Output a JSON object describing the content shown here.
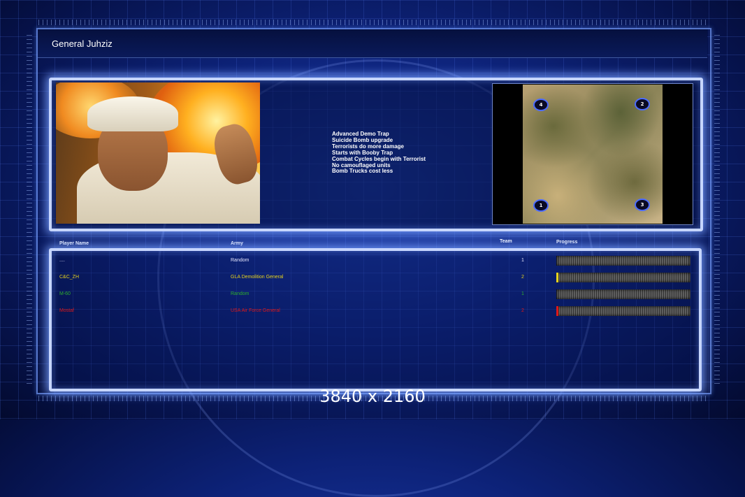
{
  "title": "General Juhziz",
  "bonuses": [
    "Advanced Demo Trap",
    "Suicide Bomb upgrade",
    "Terrorists do more damage",
    "Starts with Booby Trap",
    "Combat Cycles begin with Terrorist",
    "No camouflaged units",
    "Bomb Trucks cost less"
  ],
  "map": {
    "start_positions": [
      "4",
      "2",
      "1",
      "3"
    ]
  },
  "table": {
    "headers": {
      "player": "Player Name",
      "army": "Army",
      "team": "Team",
      "progress": "Progress"
    },
    "rows": [
      {
        "player": "....",
        "army": "Random",
        "team": "1",
        "color": "#e8e8ff",
        "progress": 0.0
      },
      {
        "player": "C&C_ZH",
        "army": "GLA Demolition General",
        "team": "2",
        "color": "#e6d21e",
        "progress": 0.015
      },
      {
        "player": "M-60",
        "army": "Random",
        "team": "1",
        "color": "#2fae2f",
        "progress": 0.0
      },
      {
        "player": "Mostaf",
        "army": "USA Air Force General",
        "team": "2",
        "color": "#e01818",
        "progress": 0.01
      }
    ]
  },
  "resolution_caption": "3840 x 2160"
}
